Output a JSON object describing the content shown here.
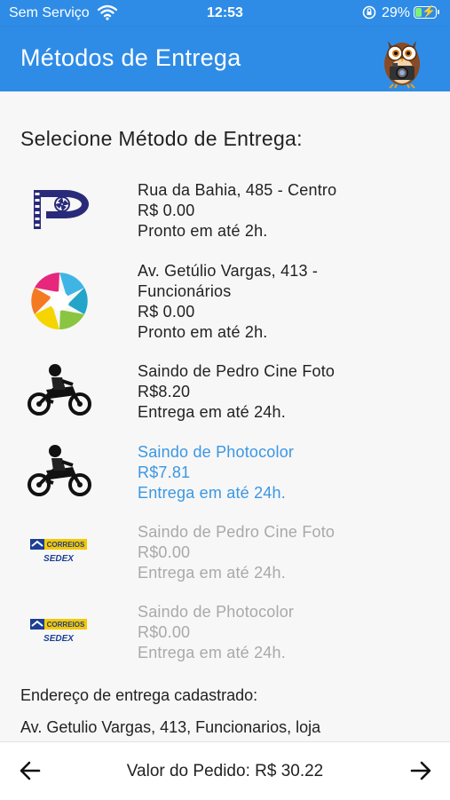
{
  "status_bar": {
    "carrier": "Sem Serviço",
    "time": "12:53",
    "battery_percent": "29%",
    "battery_level": 0.29
  },
  "app_bar": {
    "title": "Métodos de Entrega",
    "logo_icon": "owl-photographer-logo"
  },
  "main": {
    "heading": "Selecione Método de Entrega:",
    "methods": [
      {
        "icon": "pedro-cine-foto-logo",
        "state": "normal",
        "line1": "Rua da Bahia, 485 - Centro",
        "line2": "R$ 0.00",
        "line3": "Pronto em até 2h.",
        "line4": ""
      },
      {
        "icon": "photocolor-aperture-logo",
        "state": "normal",
        "line1": "Av. Getúlio Vargas, 413 -",
        "line2": "Funcionários",
        "line3": "R$ 0.00",
        "line4": "Pronto em até 2h."
      },
      {
        "icon": "motorcycle-courier-icon",
        "state": "normal",
        "line1": "Saindo de Pedro Cine Foto",
        "line2": "R$8.20",
        "line3": "Entrega em até 24h.",
        "line4": ""
      },
      {
        "icon": "motorcycle-courier-icon",
        "state": "selected",
        "line1": "Saindo de Photocolor",
        "line2": "R$7.81",
        "line3": "Entrega em até 24h.",
        "line4": ""
      },
      {
        "icon": "correios-sedex-logo",
        "state": "disabled",
        "line1": "Saindo de Pedro Cine Foto",
        "line2": "R$0.00",
        "line3": "Entrega em até 24h.",
        "line4": ""
      },
      {
        "icon": "correios-sedex-logo",
        "state": "disabled",
        "line1": "Saindo de Photocolor",
        "line2": "R$0.00",
        "line3": "Entrega em até 24h.",
        "line4": ""
      }
    ],
    "address_label": "Endereço de entrega cadastrado:",
    "address_value": "Av. Getulio Vargas, 413, Funcionarios, loja"
  },
  "bottom_bar": {
    "order_total": "Valor do Pedido: R$ 30.22",
    "back_icon": "arrow-left-icon",
    "next_icon": "arrow-right-icon"
  },
  "colors": {
    "primary": "#2e8ce6",
    "selected_text": "#3a97e3",
    "disabled_text": "#a9a9a9",
    "correios_blue": "#1b3f94",
    "correios_yellow": "#f5c800"
  }
}
